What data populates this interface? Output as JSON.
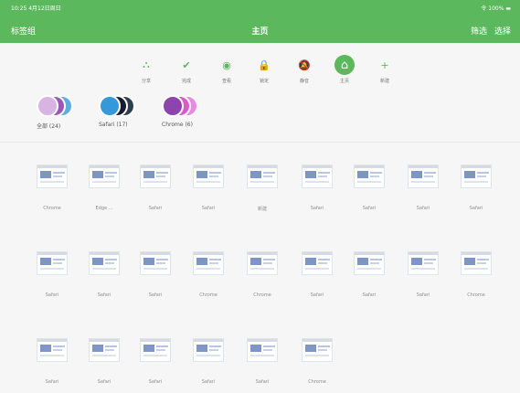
{
  "status_bar": {
    "left": "10:25 4月12日周日",
    "right": "令 100% ▬"
  },
  "nav": {
    "left_label": "标签组",
    "title": "主页",
    "right_items": [
      "筛选",
      "选择"
    ]
  },
  "toolbar": [
    {
      "name": "tool-share",
      "label": "分享",
      "icon": "share-icon",
      "symbol": "⛬"
    },
    {
      "name": "tool-done",
      "label": "完成",
      "icon": "check-circle-icon",
      "symbol": "✔"
    },
    {
      "name": "tool-view",
      "label": "查看",
      "icon": "eye-icon",
      "symbol": "◉"
    },
    {
      "name": "tool-lock",
      "label": "锁定",
      "icon": "lock-icon",
      "symbol": "🔒"
    },
    {
      "name": "tool-mute",
      "label": "静音",
      "icon": "bell-off-icon",
      "symbol": "🔕"
    },
    {
      "name": "tool-home",
      "label": "主页",
      "icon": "home-icon",
      "symbol": "⌂",
      "active": true
    },
    {
      "name": "tool-add",
      "label": "新建",
      "icon": "plus-icon",
      "symbol": "+"
    }
  ],
  "groups": [
    {
      "name": "group-all",
      "label": "全部 (24)",
      "colors": [
        "#d8b4e2",
        "#9b59b6",
        "#5dade2"
      ]
    },
    {
      "name": "group-safari",
      "label": "Safari (17)",
      "colors": [
        "#3498db",
        "#1a1a2e",
        "#2c3e50"
      ]
    },
    {
      "name": "group-chrome",
      "label": "Chrome (6)",
      "colors": [
        "#8e44ad",
        "#d35ec9",
        "#e88ae0"
      ]
    }
  ],
  "tabs": [
    {
      "caption": "Chrome"
    },
    {
      "caption": "Edge ..."
    },
    {
      "caption": "Safari"
    },
    {
      "caption": "Safari"
    },
    {
      "caption": "新建"
    },
    {
      "caption": "Safari"
    },
    {
      "caption": "Safari"
    },
    {
      "caption": "Safari"
    },
    {
      "caption": "Safari"
    },
    {
      "caption": "Safari"
    },
    {
      "caption": "Safari"
    },
    {
      "caption": "Safari"
    },
    {
      "caption": "Chrome"
    },
    {
      "caption": "Chrome"
    },
    {
      "caption": "Safari"
    },
    {
      "caption": "Safari"
    },
    {
      "caption": "Safari"
    },
    {
      "caption": "Chrome"
    },
    {
      "caption": "Safari"
    },
    {
      "caption": "Safari"
    },
    {
      "caption": "Safari"
    },
    {
      "caption": "Safari"
    },
    {
      "caption": "Safari"
    },
    {
      "caption": "Chrome"
    }
  ],
  "colors": {
    "brand": "#5cb85c",
    "background": "#f6f6f7"
  }
}
